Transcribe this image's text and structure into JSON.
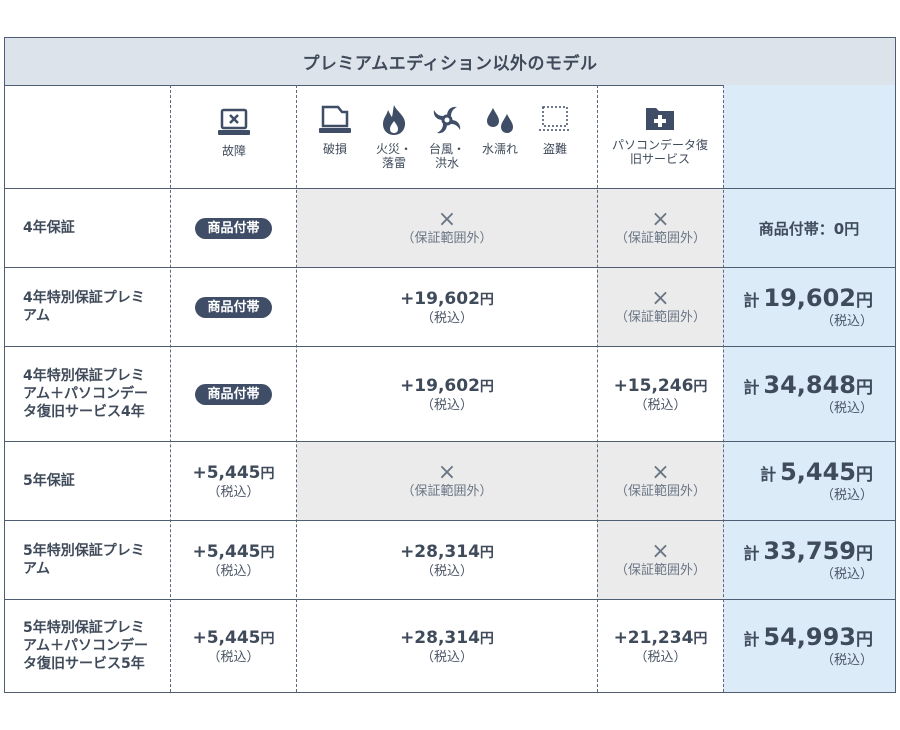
{
  "table": {
    "title": "プレミアムエディション以外のモデル",
    "headers": {
      "failure": {
        "icon": "laptop-broken-icon",
        "label": "故障"
      },
      "damage_group": [
        {
          "icon": "laptop-damaged-icon",
          "label": "破損"
        },
        {
          "icon": "fire-icon",
          "label": "火災・落雷"
        },
        {
          "icon": "typhoon-icon",
          "label": "台風・洪水"
        },
        {
          "icon": "water-drops-icon",
          "label": "水濡れ"
        },
        {
          "icon": "theft-icon",
          "label": "盗難"
        }
      ],
      "recovery": {
        "icon": "folder-plus-icon",
        "label": "パソコンデータ復旧サービス"
      }
    },
    "badge": "商品付帯",
    "cross": "×",
    "outside": "（保証範囲外）",
    "tax": "（税込）",
    "yen": "円",
    "kei": "計",
    "rows": [
      {
        "label": "4年保証",
        "failure": "badge",
        "damage": "outside",
        "recovery": "outside",
        "total_text": "商品付帯：0円"
      },
      {
        "label": "4年特別保証プレミアム",
        "failure": "badge",
        "damage": "+19,602",
        "recovery": "outside",
        "total": "19,602"
      },
      {
        "label": "4年特別保証プレミアム＋パソコンデータ復旧サービス4年",
        "failure": "badge",
        "damage": "+19,602",
        "recovery": "+15,246",
        "total": "34,848"
      },
      {
        "label": "5年保証",
        "failure": "+5,445",
        "damage": "outside",
        "recovery": "outside",
        "total": "5,445"
      },
      {
        "label": "5年特別保証プレミアム",
        "failure": "+5,445",
        "damage": "+28,314",
        "recovery": "outside",
        "total": "33,759"
      },
      {
        "label": "5年特別保証プレミアム＋パソコンデータ復旧サービス5年",
        "failure": "+5,445",
        "damage": "+28,314",
        "recovery": "+21,234",
        "total": "54,993"
      }
    ]
  }
}
